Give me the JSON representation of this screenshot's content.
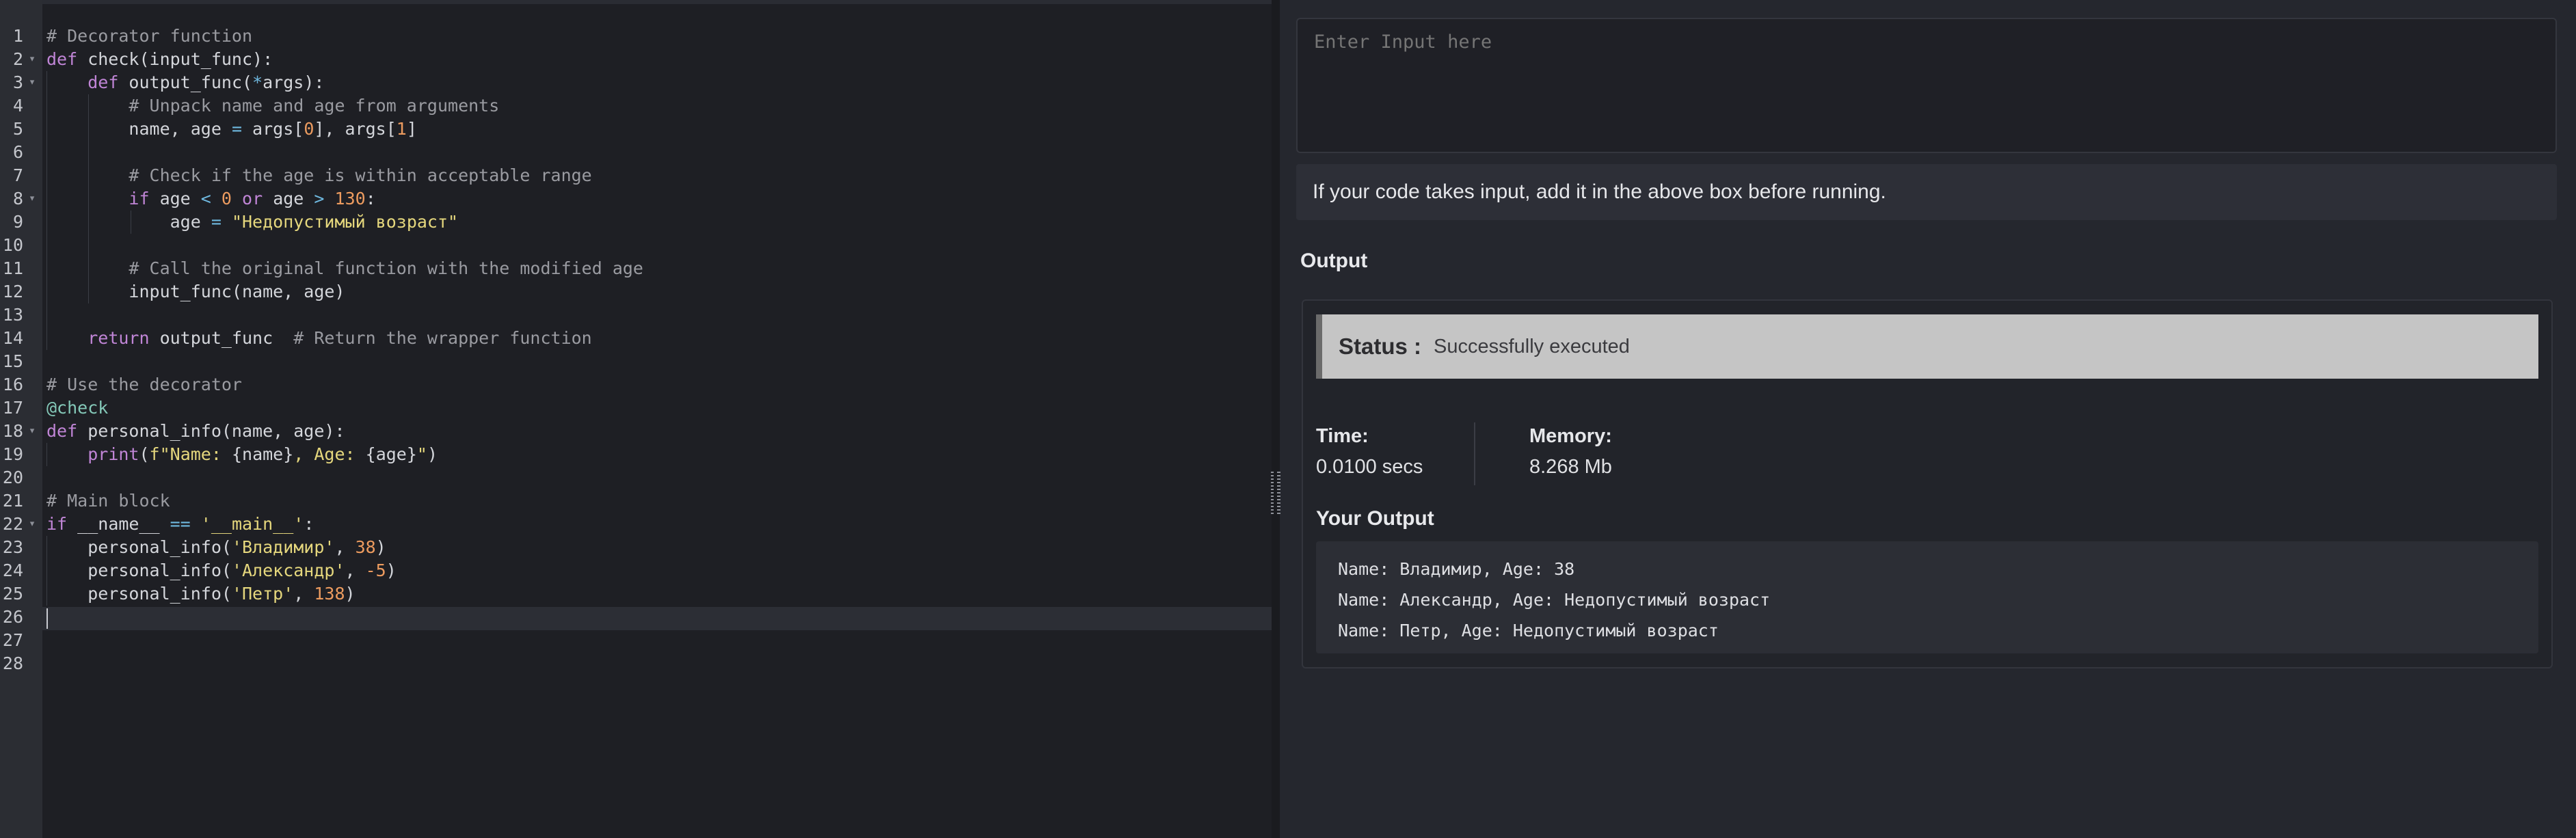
{
  "editor": {
    "line_numbers": [
      "1",
      "2",
      "3",
      "4",
      "5",
      "6",
      "7",
      "8",
      "9",
      "10",
      "11",
      "12",
      "13",
      "14",
      "15",
      "16",
      "17",
      "18",
      "19",
      "20",
      "21",
      "22",
      "23",
      "24",
      "25",
      "26",
      "27",
      "28"
    ],
    "fold_marker": "▾",
    "lines": {
      "l1": {
        "a": "# Decorator function"
      },
      "l2": {
        "a": "def",
        "b": " check(input_func):"
      },
      "l3": {
        "a": "    ",
        "b": "def",
        "c": " output_func(",
        "d": "*",
        "e": "args):"
      },
      "l4": {
        "a": "        ",
        "b": "# Unpack name and age from arguments"
      },
      "l5": {
        "a": "        name, age ",
        "b": "=",
        "c": " args[",
        "d": "0",
        "e": "], args[",
        "f": "1",
        "g": "]"
      },
      "l7": {
        "a": "        ",
        "b": "# Check if the age is within acceptable range"
      },
      "l8": {
        "a": "        ",
        "b": "if",
        "c": " age ",
        "d": "<",
        "e": " ",
        "f": "0",
        "g": " ",
        "h": "or",
        "i": " age ",
        "j": ">",
        "k": " ",
        "l": "130",
        "m": ":"
      },
      "l9": {
        "a": "            age ",
        "b": "=",
        "c": " ",
        "d": "\"Недопустимый возраст\""
      },
      "l11": {
        "a": "        ",
        "b": "# Call the original function with the modified age"
      },
      "l12": {
        "a": "        input_func(name, age)"
      },
      "l14": {
        "a": "    ",
        "b": "return",
        "c": " output_func  ",
        "d": "# Return the wrapper function"
      },
      "l16": {
        "a": "# Use the decorator"
      },
      "l17": {
        "a": "@check"
      },
      "l18": {
        "a": "def",
        "b": " personal_info(name, age):"
      },
      "l19": {
        "a": "    ",
        "b": "print",
        "c": "(",
        "d": "f\"Name: ",
        "e": "{name}",
        "f": ", Age: ",
        "g": "{age}",
        "h": "\"",
        "i": ")"
      },
      "l21": {
        "a": "# Main block"
      },
      "l22": {
        "a": "if",
        "b": " __name__ ",
        "c": "==",
        "d": " ",
        "e": "'__main__'",
        "f": ":"
      },
      "l23": {
        "a": "    personal_info(",
        "b": "'Владимир'",
        "c": ", ",
        "d": "38",
        "e": ")"
      },
      "l24": {
        "a": "    personal_info(",
        "b": "'Александр'",
        "c": ", ",
        "d": "-5",
        "e": ")"
      },
      "l25": {
        "a": "    personal_info(",
        "b": "'Петр'",
        "c": ", ",
        "d": "138",
        "e": ")"
      }
    }
  },
  "input": {
    "placeholder": "Enter Input here",
    "value": ""
  },
  "hint": "If your code takes input, add it in the above box before running.",
  "output": {
    "label": "Output",
    "status_label": "Status :",
    "status_value": "Successfully executed",
    "time_label": "Time:",
    "time_value": "0.0100 secs",
    "memory_label": "Memory:",
    "memory_value": "8.268 Mb",
    "your_output_label": "Your Output",
    "stdout": [
      "Name: Владимир, Age: 38",
      "Name: Александр, Age: Недопустимый возраст",
      "Name: Петр, Age: Недопустимый возраст"
    ]
  },
  "colors": {
    "editor_bg": "#1e1f24",
    "gutter_bg": "#2b2d33",
    "comment": "#9a9ba1",
    "keyword": "#c085d6",
    "string": "#e5d77d",
    "number": "#ec9b5f",
    "operator": "#6fb9e0",
    "status_bar": "#c5c5c5"
  },
  "icons": {
    "splitter": "drag-handle-icon",
    "fold": "fold-arrow-icon"
  }
}
